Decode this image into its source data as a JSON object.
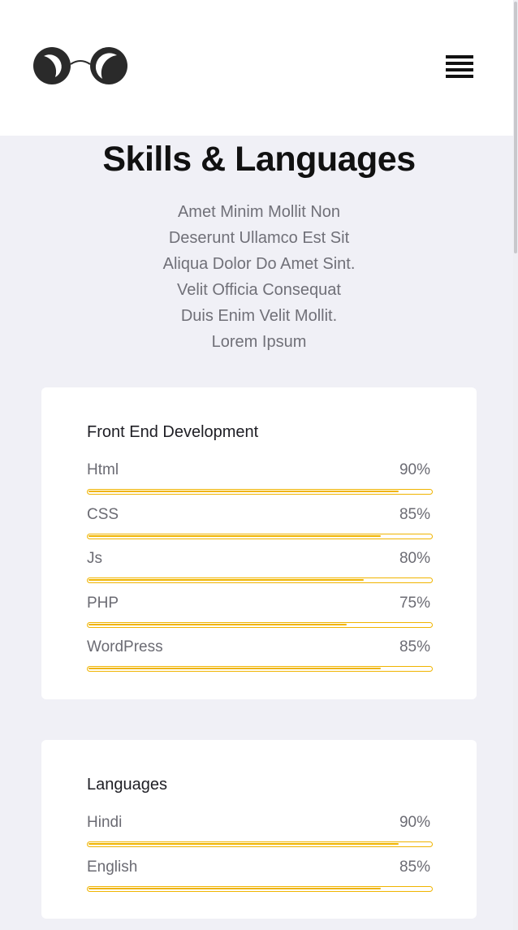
{
  "header": {
    "logo_icon": "glasses-logo-icon",
    "menu_icon": "hamburger-menu-icon"
  },
  "section": {
    "title": "Skills & Languages",
    "description_lines": [
      "Amet Minim Mollit Non",
      "Deserunt Ullamco Est Sit",
      "Aliqua Dolor Do Amet Sint.",
      "Velit Officia Consequat",
      "Duis Enim Velit Mollit.",
      "Lorem Ipsum"
    ]
  },
  "cards": [
    {
      "title": "Front End Development",
      "skills": [
        {
          "name": "Html",
          "percent_label": "90%",
          "level": 0.9
        },
        {
          "name": "CSS",
          "percent_label": "85%",
          "level": 0.85
        },
        {
          "name": "Js",
          "percent_label": "80%",
          "level": 0.8
        },
        {
          "name": "PHP",
          "percent_label": "75%",
          "level": 0.75
        },
        {
          "name": "WordPress",
          "percent_label": "85%",
          "level": 0.85
        }
      ]
    },
    {
      "title": "Languages",
      "skills": [
        {
          "name": "Hindi",
          "percent_label": "90%",
          "level": 0.9
        },
        {
          "name": "English",
          "percent_label": "85%",
          "level": 0.85
        }
      ]
    }
  ],
  "colors": {
    "accent": "#f0b400",
    "background": "#f0f0f6",
    "card": "#ffffff"
  }
}
